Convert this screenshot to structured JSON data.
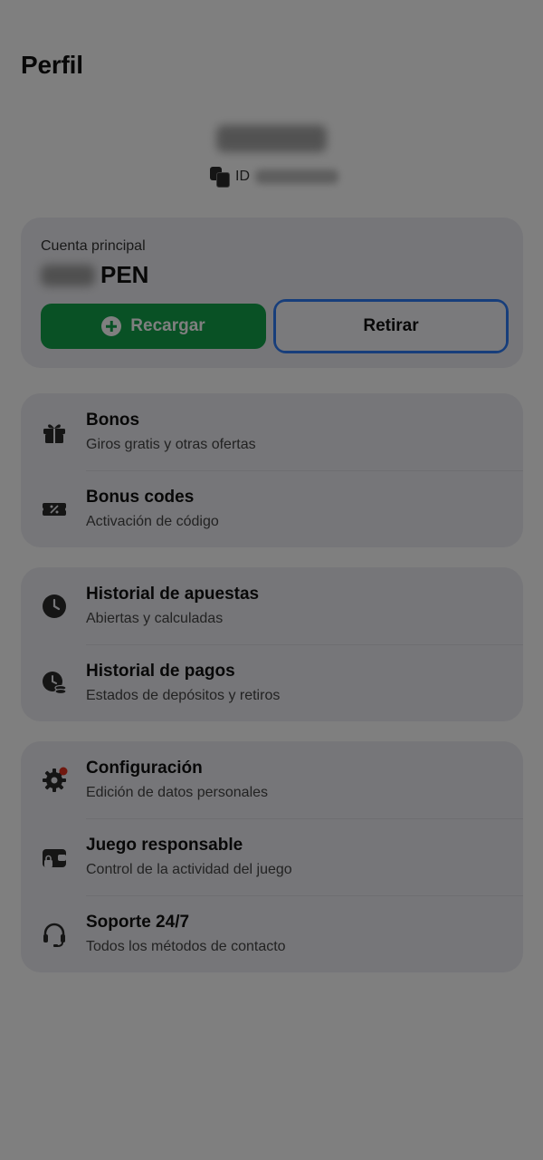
{
  "header": {
    "title": "Perfil"
  },
  "profile": {
    "id_label": "ID"
  },
  "account": {
    "label": "Cuenta principal",
    "currency": "PEN",
    "deposit_label": "Recargar",
    "withdraw_label": "Retirar"
  },
  "colors": {
    "deposit_green": "#13a34b",
    "focus_blue": "#2f7cf6",
    "notification_red": "#e0311f"
  },
  "menu": {
    "bonuses": {
      "label": "Bonos",
      "sub": "Giros gratis y otras ofertas",
      "icon": "gift-icon"
    },
    "bonus_codes": {
      "label": "Bonus codes",
      "sub": "Activación de código",
      "icon": "ticket-percent-icon"
    },
    "bet_history": {
      "label": "Historial de apuestas",
      "sub": "Abiertas y calculadas",
      "icon": "clock-icon"
    },
    "payment_history": {
      "label": "Historial de pagos",
      "sub": "Estados de depósitos y retiros",
      "icon": "clock-coins-icon"
    },
    "settings": {
      "label": "Configuración",
      "sub": "Edición de datos personales",
      "icon": "gear-icon"
    },
    "responsible_gaming": {
      "label": "Juego responsable",
      "sub": "Control de la actividad del juego",
      "icon": "wallet-lock-icon"
    },
    "support": {
      "label": "Soporte 24/7",
      "sub": "Todos los métodos de contacto",
      "icon": "headset-icon"
    }
  }
}
